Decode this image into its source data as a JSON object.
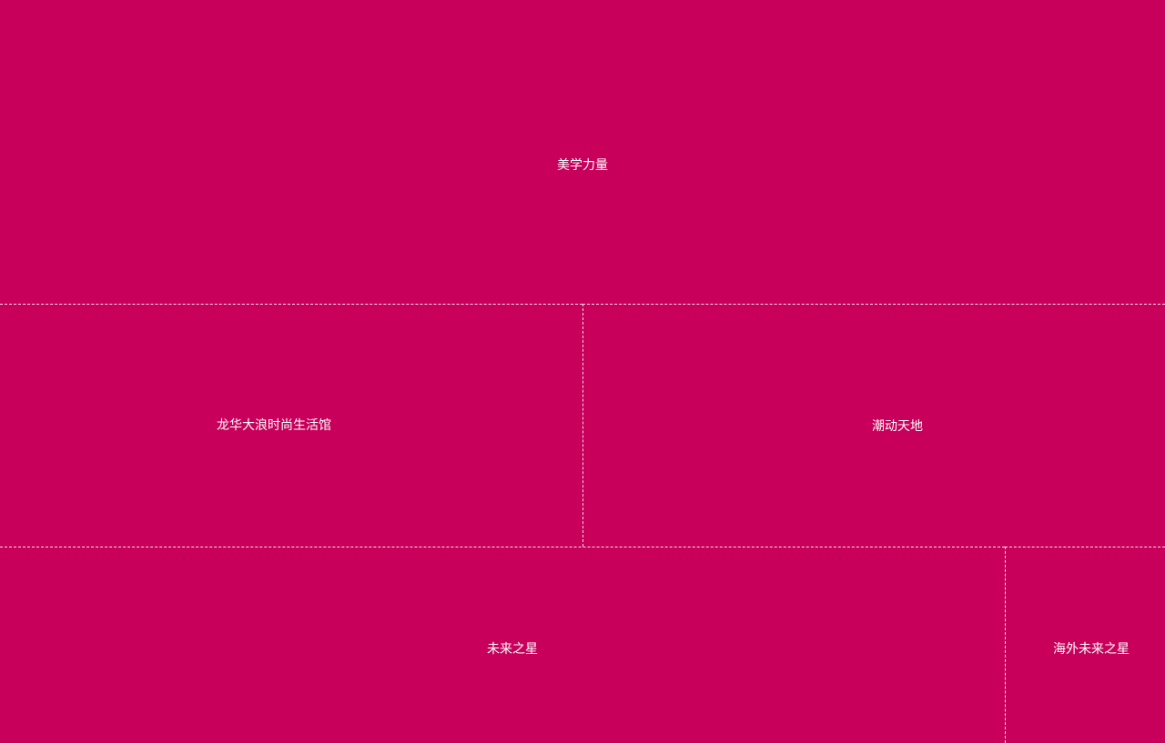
{
  "colors": {
    "background": "#c8005c",
    "label": "#ffffff",
    "divider": "#ffffff"
  },
  "treemap": {
    "tiles": [
      {
        "label": "美学力量"
      },
      {
        "label": "龙华大浪时尚生活馆"
      },
      {
        "label": "潮动天地"
      },
      {
        "label": "未来之星"
      },
      {
        "label": "海外未来之星"
      }
    ]
  }
}
